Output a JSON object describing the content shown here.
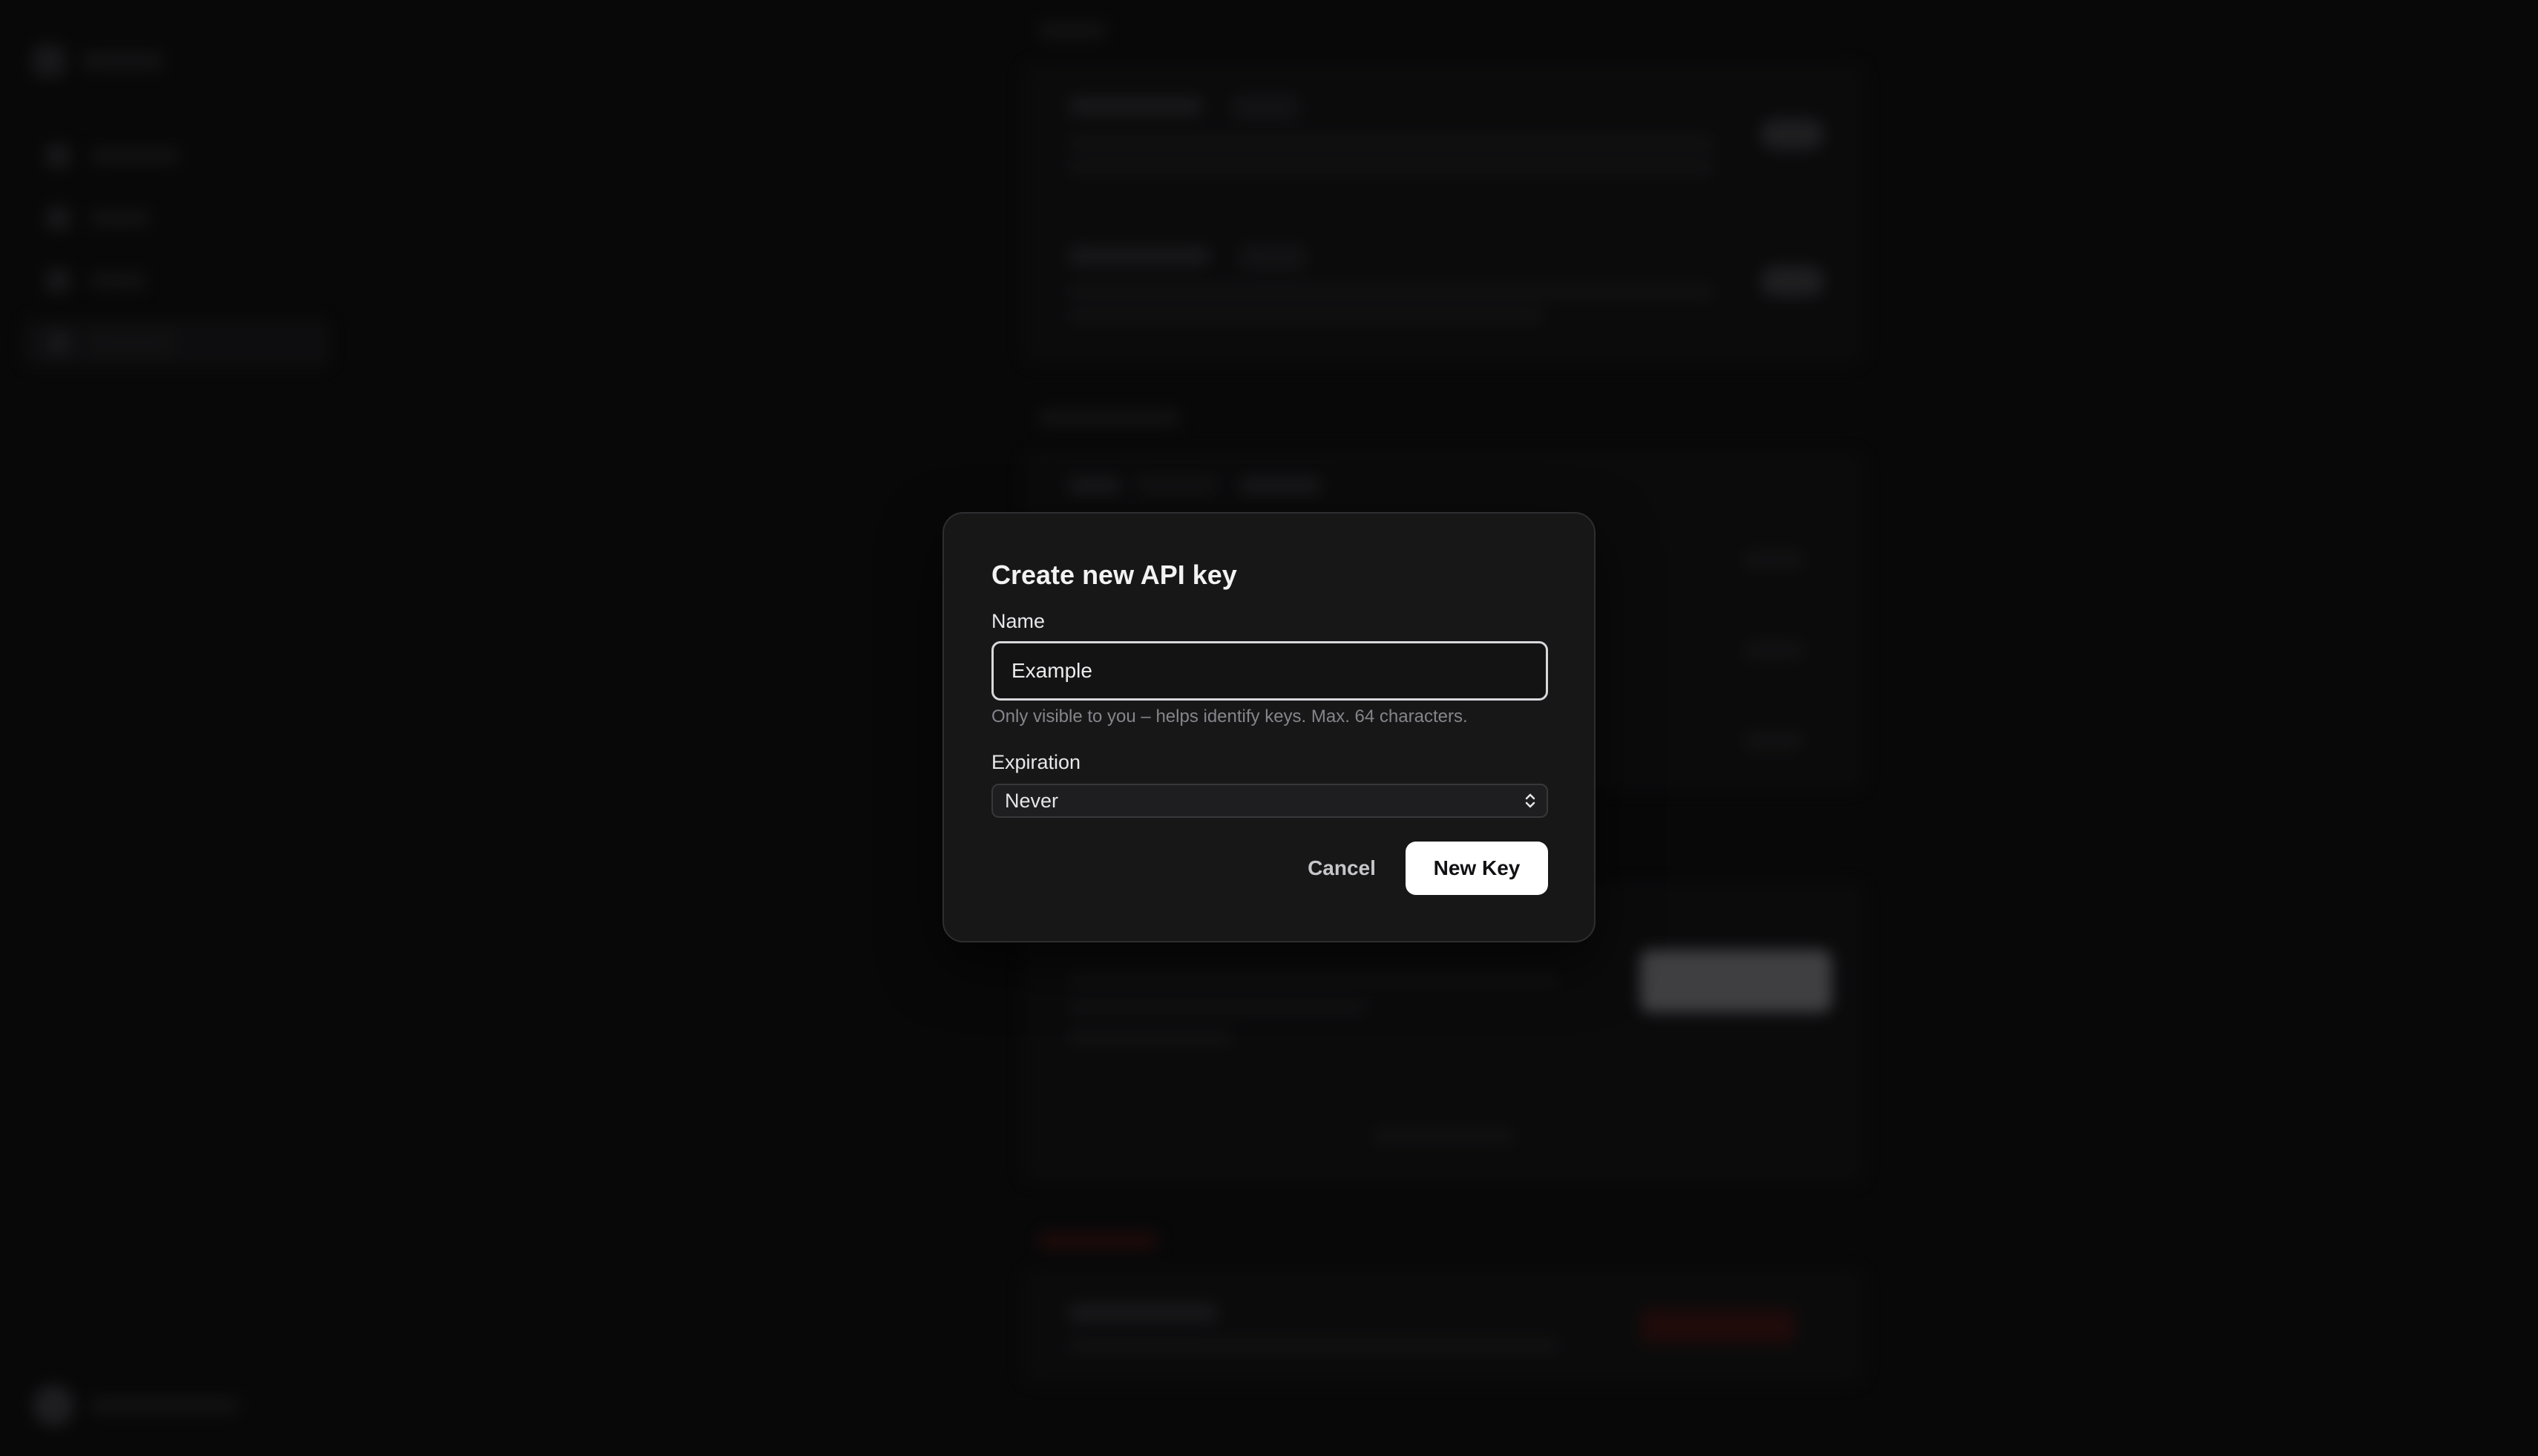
{
  "dialog": {
    "title": "Create new API key",
    "name_label": "Name",
    "name_value": "Example",
    "name_hint": "Only visible to you – helps identify keys. Max. 64 characters.",
    "expiration_label": "Expiration",
    "expiration_value": "Never",
    "cancel_label": "Cancel",
    "submit_label": "New Key"
  },
  "background": {
    "icons": [
      "logo-icon",
      "nav-icon",
      "avatar"
    ]
  },
  "colors": {
    "page_bg": "#0d0d0e",
    "modal_bg": "#171718",
    "primary_button": "#ffffff",
    "danger": "#8a2b25"
  }
}
